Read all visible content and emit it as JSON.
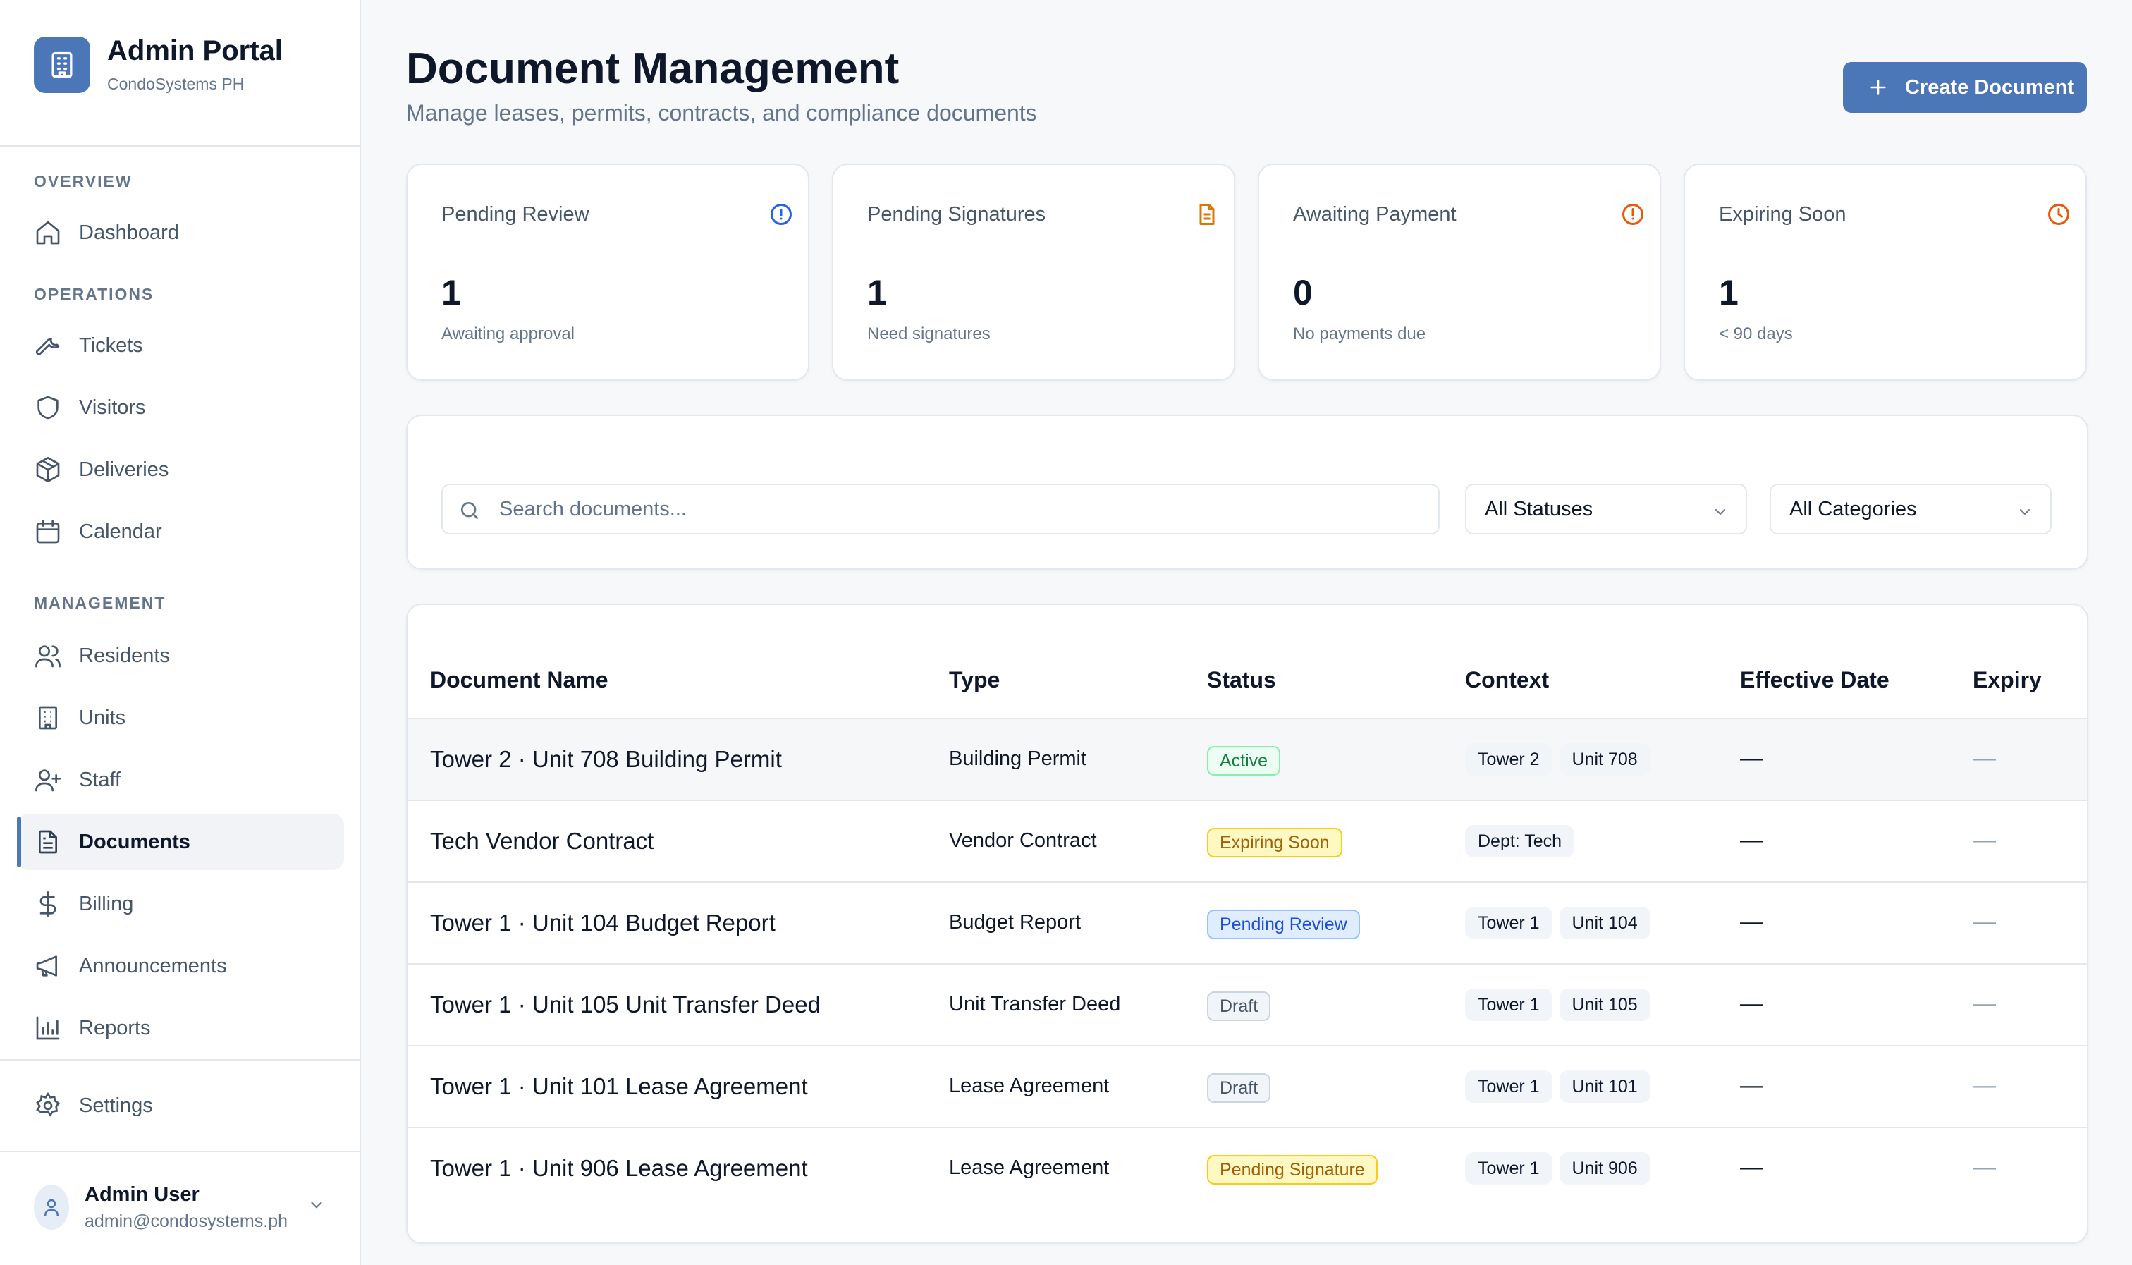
{
  "brand": {
    "title": "Admin Portal",
    "subtitle": "CondoSystems PH"
  },
  "nav": {
    "sections": [
      {
        "label": "OVERVIEW",
        "items": [
          {
            "label": "Dashboard",
            "icon": "home-icon"
          }
        ]
      },
      {
        "label": "OPERATIONS",
        "items": [
          {
            "label": "Tickets",
            "icon": "wrench-icon"
          },
          {
            "label": "Visitors",
            "icon": "shield-icon"
          },
          {
            "label": "Deliveries",
            "icon": "package-icon"
          },
          {
            "label": "Calendar",
            "icon": "calendar-icon"
          }
        ]
      },
      {
        "label": "MANAGEMENT",
        "items": [
          {
            "label": "Residents",
            "icon": "users-icon"
          },
          {
            "label": "Units",
            "icon": "building-icon"
          },
          {
            "label": "Staff",
            "icon": "user-plus-icon"
          },
          {
            "label": "Documents",
            "icon": "document-icon",
            "active": true
          },
          {
            "label": "Billing",
            "icon": "dollar-icon"
          },
          {
            "label": "Announcements",
            "icon": "megaphone-icon"
          },
          {
            "label": "Reports",
            "icon": "bar-chart-icon"
          }
        ]
      }
    ],
    "settings": {
      "label": "Settings",
      "icon": "gear-icon"
    }
  },
  "user": {
    "name": "Admin User",
    "email": "admin@condosystems.ph"
  },
  "header": {
    "title": "Document Management",
    "subtitle": "Manage leases, permits, contracts, and compliance documents",
    "create_label": "Create Document"
  },
  "stats": [
    {
      "label": "Pending Review",
      "value": "1",
      "caption": "Awaiting approval",
      "icon": "info-circle-icon",
      "color": "#2563eb"
    },
    {
      "label": "Pending Signatures",
      "value": "1",
      "caption": "Need signatures",
      "icon": "file-text-icon",
      "color": "#d97706"
    },
    {
      "label": "Awaiting Payment",
      "value": "0",
      "caption": "No payments due",
      "icon": "alert-circle-icon",
      "color": "#ea580c"
    },
    {
      "label": "Expiring Soon",
      "value": "1",
      "caption": "< 90 days",
      "icon": "clock-icon",
      "color": "#ea580c"
    }
  ],
  "filters": {
    "search_placeholder": "Search documents...",
    "status_selected": "All Statuses",
    "category_selected": "All Categories"
  },
  "table": {
    "columns": [
      "Document Name",
      "Type",
      "Status",
      "Context",
      "Effective Date",
      "Expiry"
    ],
    "rows": [
      {
        "name": "Tower 2 · Unit 708 Building Permit",
        "type": "Building Permit",
        "status": "Active",
        "context": [
          "Tower 2",
          "Unit 708"
        ],
        "effective": "—",
        "expiry": "—"
      },
      {
        "name": "Tech Vendor Contract",
        "type": "Vendor Contract",
        "status": "Expiring Soon",
        "context": [
          "Dept: Tech"
        ],
        "effective": "—",
        "expiry": "—"
      },
      {
        "name": "Tower 1 · Unit 104 Budget Report",
        "type": "Budget Report",
        "status": "Pending Review",
        "context": [
          "Tower 1",
          "Unit 104"
        ],
        "effective": "—",
        "expiry": "—"
      },
      {
        "name": "Tower 1 · Unit 105 Unit Transfer Deed",
        "type": "Unit Transfer Deed",
        "status": "Draft",
        "context": [
          "Tower 1",
          "Unit 105"
        ],
        "effective": "—",
        "expiry": "—"
      },
      {
        "name": "Tower 1 · Unit 101 Lease Agreement",
        "type": "Lease Agreement",
        "status": "Draft",
        "context": [
          "Tower 1",
          "Unit 101"
        ],
        "effective": "—",
        "expiry": "—"
      },
      {
        "name": "Tower 1 · Unit 906 Lease Agreement",
        "type": "Lease Agreement",
        "status": "Pending Signature",
        "context": [
          "Tower 1",
          "Unit 906"
        ],
        "effective": "—",
        "expiry": "—"
      }
    ]
  },
  "colors": {
    "accent": "#4b76b8",
    "text": "#0f172a",
    "muted": "#64748b"
  }
}
